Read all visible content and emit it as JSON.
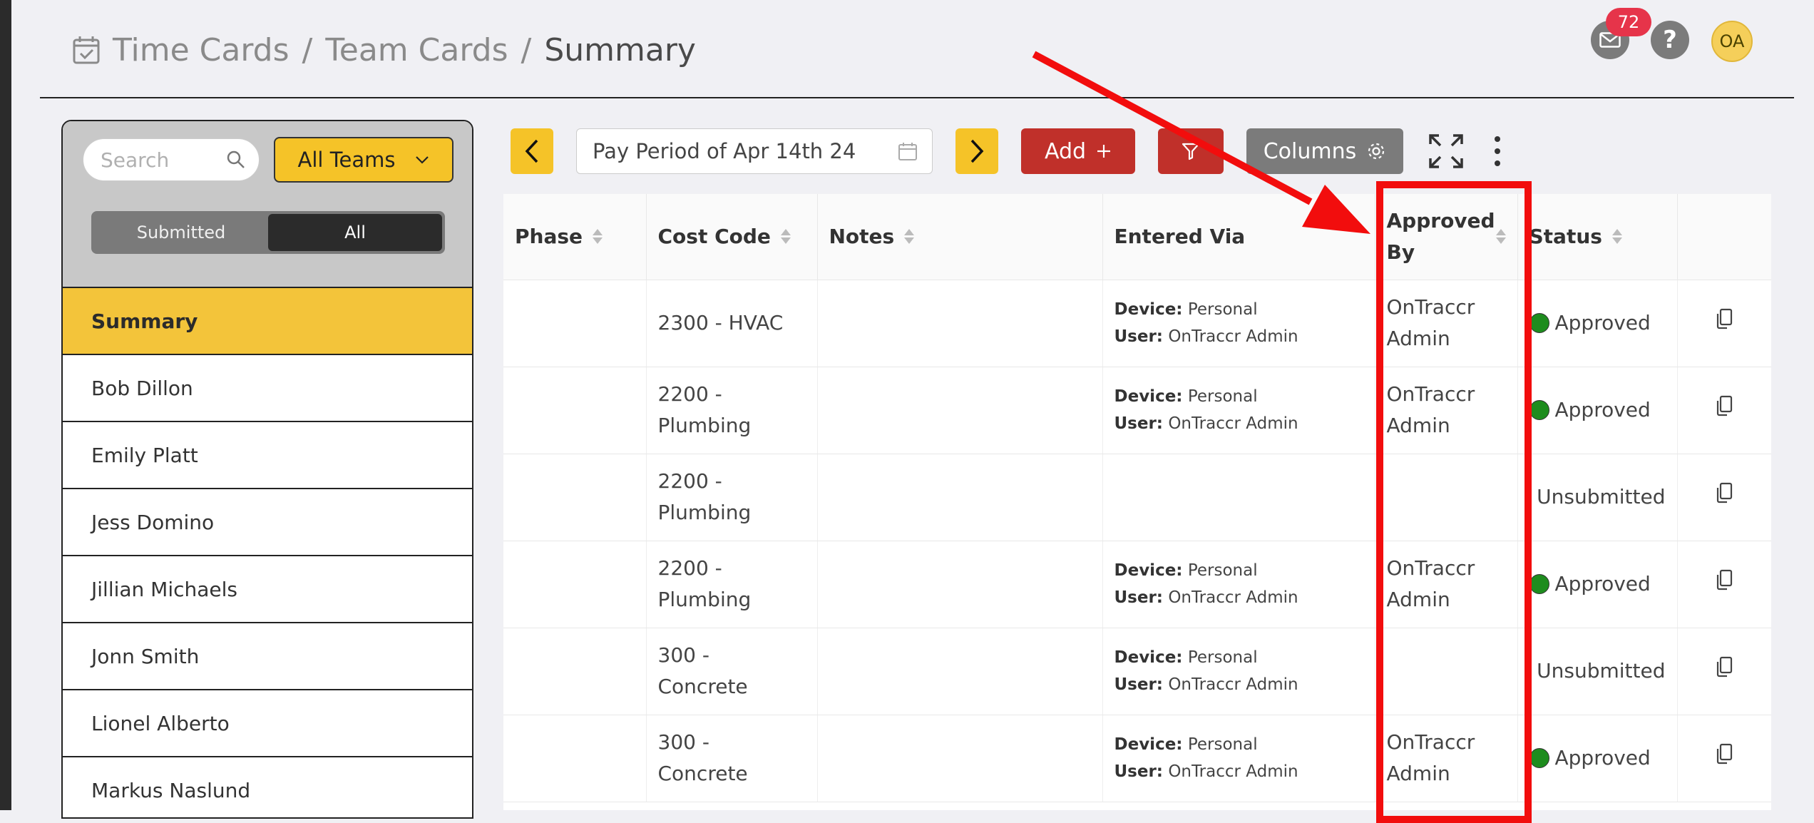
{
  "breadcrumb": {
    "items": [
      "Time Cards",
      "Team Cards",
      "Summary"
    ],
    "separator": "/"
  },
  "header": {
    "mail_badge": "72",
    "help_glyph": "?",
    "avatar_initials": "OA"
  },
  "sidebar": {
    "search_placeholder": "Search",
    "team_select": "All Teams",
    "toggle": [
      "Submitted",
      "All"
    ],
    "members": [
      "Summary",
      "Bob Dillon",
      "Emily Platt",
      "Jess Domino",
      "Jillian Michaels",
      "Jonn Smith",
      "Lionel Alberto",
      "Markus Naslund"
    ]
  },
  "toolbar": {
    "prev_glyph": "<",
    "next_glyph": ">",
    "pay_period": "Pay Period of Apr 14th 24",
    "add_label": "Add",
    "columns_label": "Columns"
  },
  "table": {
    "headers": [
      "Phase",
      "Cost Code",
      "Notes",
      "Entered Via",
      "Approved By",
      "Status"
    ],
    "device_label": "Device:",
    "user_label": "User:",
    "rows": [
      {
        "phase": "",
        "cost_code": "2300 - HVAC",
        "notes": "",
        "device": "Personal",
        "user": "OnTraccr Admin",
        "approved_by": "OnTraccr Admin",
        "status": "Approved"
      },
      {
        "phase": "",
        "cost_code": "2200 - Plumbing",
        "notes": "",
        "device": "Personal",
        "user": "OnTraccr Admin",
        "approved_by": "OnTraccr Admin",
        "status": "Approved"
      },
      {
        "phase": "",
        "cost_code": "2200 - Plumbing",
        "notes": "",
        "device": "",
        "user": "",
        "approved_by": "",
        "status": "Unsubmitted"
      },
      {
        "phase": "",
        "cost_code": "2200 - Plumbing",
        "notes": "",
        "device": "Personal",
        "user": "OnTraccr Admin",
        "approved_by": "OnTraccr Admin",
        "status": "Approved"
      },
      {
        "phase": "",
        "cost_code": "300 - Concrete",
        "notes": "",
        "device": "Personal",
        "user": "OnTraccr Admin",
        "approved_by": "",
        "status": "Unsubmitted"
      },
      {
        "phase": "",
        "cost_code": "300 - Concrete",
        "notes": "",
        "device": "Personal",
        "user": "OnTraccr Admin",
        "approved_by": "OnTraccr Admin",
        "status": "Approved"
      }
    ]
  },
  "colors": {
    "accent_yellow": "#f5c328",
    "danger_red": "#c0302a",
    "approved_green": "#1e8c1e",
    "unsubmitted_black": "#000000",
    "annotation_red": "#f20d0d"
  }
}
